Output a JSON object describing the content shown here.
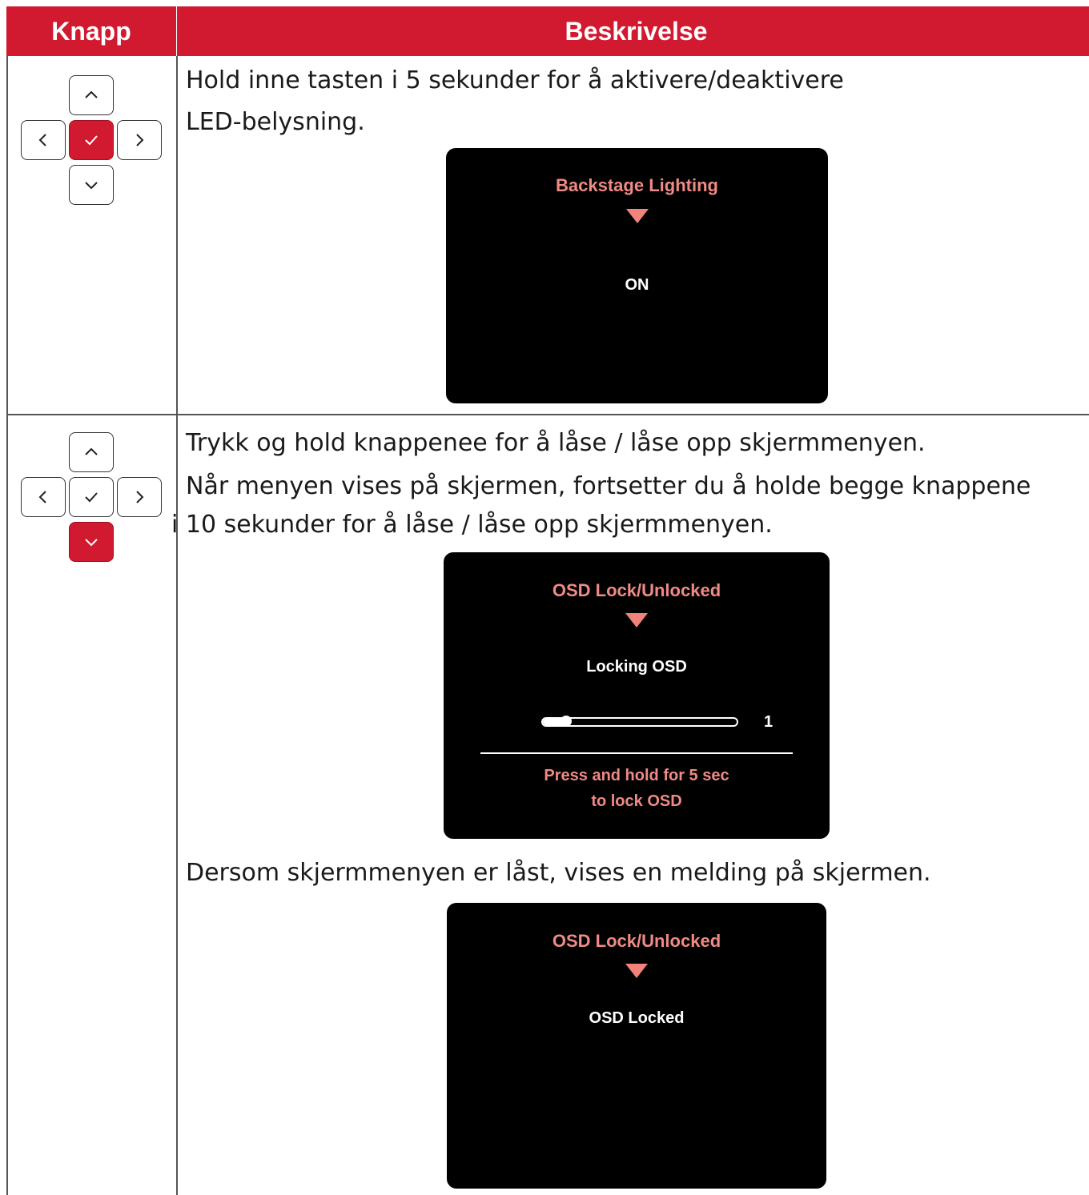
{
  "header": {
    "col_button": "Knapp",
    "col_description": "Beskrivelse"
  },
  "colors": {
    "accent": "#d11a2f",
    "osd_title": "#f08a84",
    "osd_bg": "#000000"
  },
  "rows": [
    {
      "dpad_highlight": "center",
      "description_lines": [
        "Hold inne tasten i 5 sekunder for å aktivere/deaktivere",
        "LED-belysning."
      ],
      "osd": {
        "title": "Backstage Lighting",
        "value": "ON"
      }
    },
    {
      "dpad_highlight": "down",
      "description_lines": [
        "Trykk og hold knappenee for å låse / låse opp skjermmenyen.",
        "Når menyen vises på skjermen, fortsetter du å holde begge knappene",
        "i 10 sekunder for å låse / låse opp skjermmenyen."
      ],
      "osd": {
        "title": "OSD Lock/Unlocked",
        "value": "Locking OSD",
        "progress_value": "1",
        "progress_fraction": 0.12,
        "note_lines": [
          "Press and hold for 5 sec",
          "to lock OSD"
        ]
      },
      "after_text": "Dersom skjermmenyen er låst, vises en melding på skjermen.",
      "osd2": {
        "title": "OSD Lock/Unlocked",
        "value": "OSD Locked"
      }
    }
  ]
}
